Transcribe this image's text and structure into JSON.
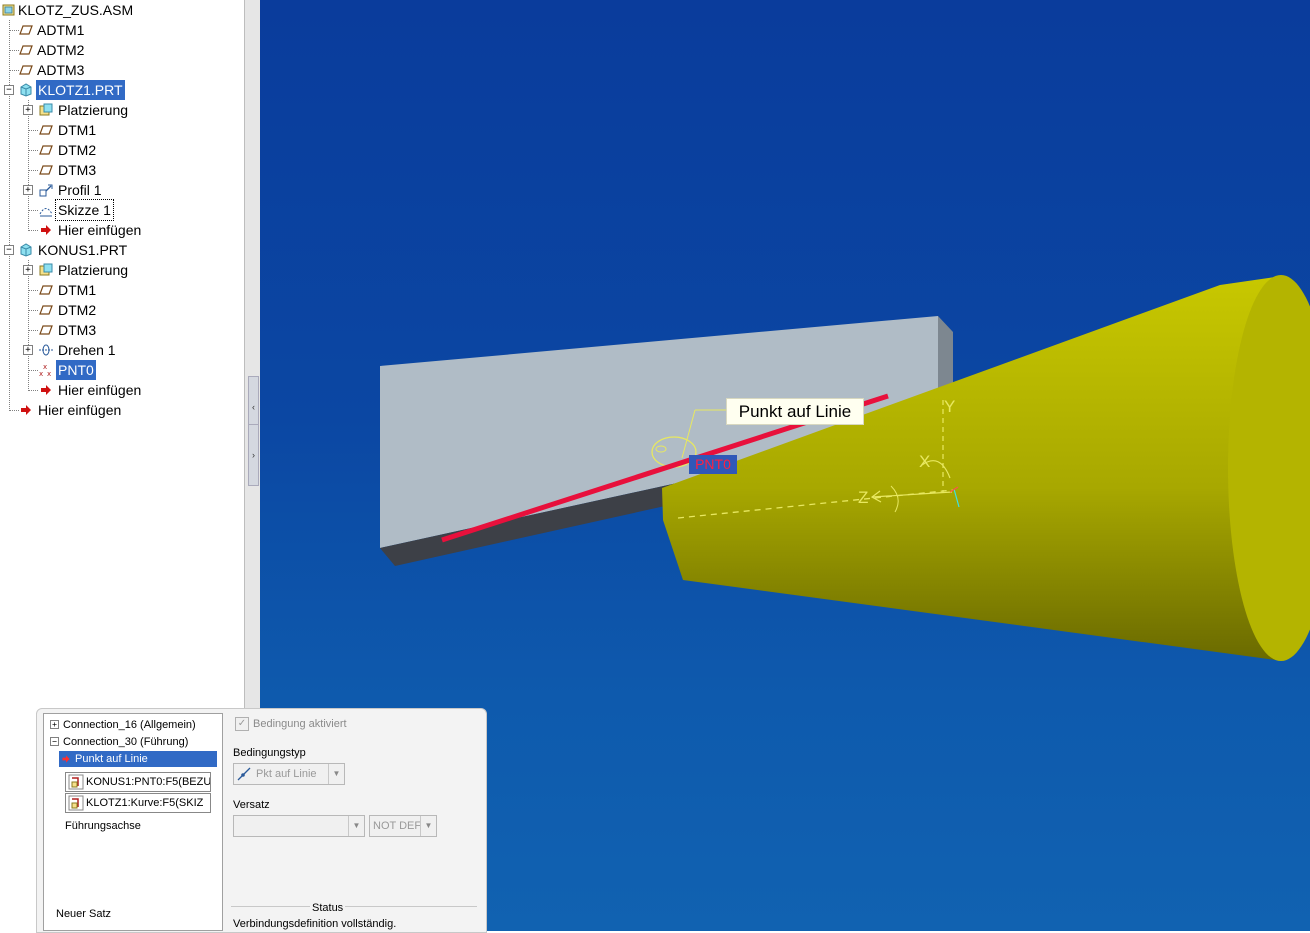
{
  "tree": {
    "items": [
      {
        "label": "KLOTZ_ZUS.ASM",
        "icon": "assembly-icon"
      },
      {
        "label": "ADTM1",
        "icon": "datum-plane-icon"
      },
      {
        "label": "ADTM2",
        "icon": "datum-plane-icon"
      },
      {
        "label": "ADTM3",
        "icon": "datum-plane-icon"
      },
      {
        "label": "KLOTZ1.PRT",
        "icon": "part-icon",
        "selected": true
      },
      {
        "label": "Platzierung",
        "icon": "placement-icon"
      },
      {
        "label": "DTM1",
        "icon": "datum-plane-icon"
      },
      {
        "label": "DTM2",
        "icon": "datum-plane-icon"
      },
      {
        "label": "DTM3",
        "icon": "datum-plane-icon"
      },
      {
        "label": "Profil 1",
        "icon": "extrude-icon"
      },
      {
        "label": "Skizze 1",
        "icon": "sketch-icon"
      },
      {
        "label": "Hier einfügen",
        "icon": "insert-arrow-icon"
      },
      {
        "label": "KONUS1.PRT",
        "icon": "part-icon"
      },
      {
        "label": "Platzierung",
        "icon": "placement-icon"
      },
      {
        "label": "DTM1",
        "icon": "datum-plane-icon"
      },
      {
        "label": "DTM2",
        "icon": "datum-plane-icon"
      },
      {
        "label": "DTM3",
        "icon": "datum-plane-icon"
      },
      {
        "label": "Drehen 1",
        "icon": "revolve-icon"
      },
      {
        "label": "PNT0",
        "icon": "datum-point-icon",
        "selected": true
      },
      {
        "label": "Hier einfügen",
        "icon": "insert-arrow-icon"
      },
      {
        "label": "Hier einfügen",
        "icon": "insert-arrow-icon"
      }
    ]
  },
  "viewport": {
    "annotation": "Punkt auf Linie",
    "point_label": "PNT0",
    "axes": {
      "x": "X",
      "y": "Y",
      "z": "Z"
    }
  },
  "colors": {
    "viewport_top": "#0a3c9c",
    "viewport_bottom": "#1162b1",
    "cone": "#b4b400",
    "block": "#b0bcc6",
    "constraint_line": "#e8103c",
    "selection": "#316ac5"
  },
  "dialog": {
    "connections": [
      {
        "label": "Connection_16 (Allgemein)",
        "expander": "+"
      },
      {
        "label": "Connection_30 (Führung)",
        "expander": "−"
      }
    ],
    "constraint": "Punkt auf Linie",
    "references": [
      "KONUS1:PNT0:F5(BEZU",
      "KLOTZ1:Kurve:F5(SKIZ"
    ],
    "guide_axis": "Führungsachse",
    "new_set": "Neuer Satz",
    "enable_label": "Bedingung aktiviert",
    "type_label": "Bedingungstyp",
    "type_value": "Pkt auf Linie",
    "offset_label": "Versatz",
    "offset_value": "",
    "offset_unit": "NOT DEF",
    "status_label": "Status",
    "status_text": "Verbindungsdefinition vollständig."
  }
}
